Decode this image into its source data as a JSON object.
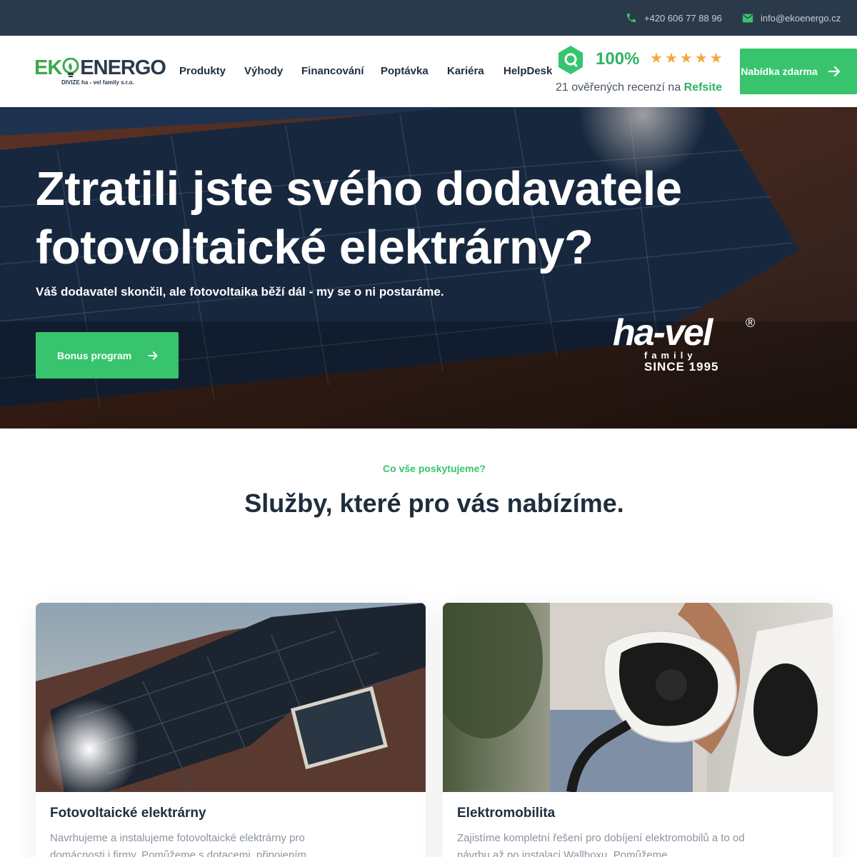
{
  "topbar": {
    "phone": "+420 606 77 88 96",
    "email": "info@ekoenergo.cz"
  },
  "logo": {
    "part1": "EK",
    "part2": "ENERGO",
    "subtitle": "DIVIZE ha - vel family s.r.o."
  },
  "nav": {
    "items": [
      "Produkty",
      "Výhody",
      "Financování",
      "Poptávka",
      "Kariéra",
      "HelpDesk"
    ]
  },
  "rating": {
    "percent": "100%",
    "stars": 5,
    "reviews_text": "21 ověřených recenzí na",
    "platform": "Refsite"
  },
  "cta_top": {
    "label": "Nabídka zdarma"
  },
  "hero": {
    "title": "Ztratili jste svého dodavatele fotovoltaické elektrárny?",
    "subtitle": "Váš dodavatel skončil, ale fotovoltaika běží dál - my se o ni postaráme.",
    "button_label": "Bonus program",
    "partner_logo": "ha-vel",
    "partner_reg": "®",
    "partner_family": "family",
    "partner_since": "SINCE 1995"
  },
  "services": {
    "eyebrow": "Co vše poskytujeme?",
    "title": "Služby, které pro vás nabízíme.",
    "cards": [
      {
        "title": "Fotovoltaické elektrárny",
        "text": "Navrhujeme a instalujeme fotovoltaické elektrárny pro domácnosti i firmy. Pomůžeme s dotacemi, připojením"
      },
      {
        "title": "Elektromobilita",
        "text": "Zajistíme kompletní řešení pro dobíjení elektromobilů a to od návrhu až po instalaci Wallboxu. Pomůžeme"
      }
    ]
  },
  "colors": {
    "accent": "#37c46d",
    "dark": "#2b3a4a",
    "star": "#f1a93a"
  }
}
